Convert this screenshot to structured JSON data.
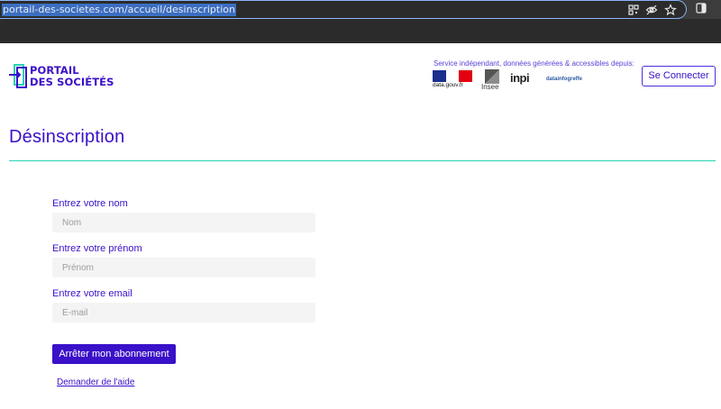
{
  "browser": {
    "url": "portail-des-societes.com/accueil/desinscription"
  },
  "header": {
    "logo_line1": "PORTAIL",
    "logo_line2": "DES SOCIÉTÉS",
    "service_text": "Service indépendant, données générées & accessibles depuis:",
    "partners": {
      "datagouv": "data.gouv.fr",
      "insee": "Insee",
      "inpi": "inpi",
      "infogreffe": "datainfogreffe"
    },
    "connect_label": "Se Connecter"
  },
  "page": {
    "title": "Désinscription"
  },
  "form": {
    "nom_label": "Entrez votre nom",
    "nom_placeholder": "Nom",
    "prenom_label": "Entrez votre prénom",
    "prenom_placeholder": "Prénom",
    "email_label": "Entrez votre email",
    "email_placeholder": "E-mail",
    "submit_label": "Arrêter mon abonnement",
    "help_label": "Demander de l'aide"
  },
  "colors": {
    "brand": "#3a10c8",
    "accent_rule": "#29d3b3",
    "input_bg": "#f4f4f4"
  }
}
